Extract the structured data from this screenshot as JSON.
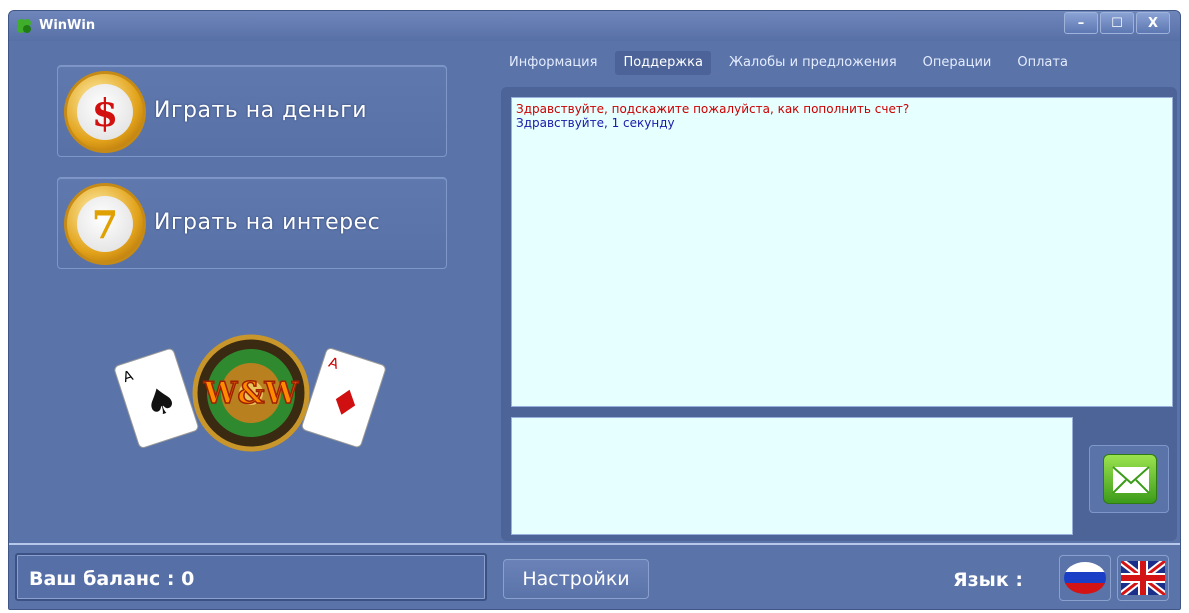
{
  "window": {
    "title": "WinWin",
    "minimize": "–",
    "maximize": "☐",
    "close": "X"
  },
  "left": {
    "play_money": "Играть на деньги",
    "play_interest": "Играть на интерес",
    "money_icon_symbol": "$",
    "interest_icon_symbol": "7"
  },
  "tabs": [
    {
      "label": "Информация"
    },
    {
      "label": "Поддержка",
      "active": true
    },
    {
      "label": "Жалобы и предложения"
    },
    {
      "label": "Операции"
    },
    {
      "label": "Оплата"
    }
  ],
  "chat": {
    "messages": [
      {
        "text": "Здравствуйте, подскажите пожалуйста, как пополнить счет?",
        "color": "#cc0000"
      },
      {
        "text": "Здравствуйте, 1 секунду",
        "color": "#1a1aa8"
      }
    ],
    "input_value": ""
  },
  "bottom": {
    "balance": "Ваш баланс : 0",
    "settings": "Настройки",
    "language_label": "Язык :"
  },
  "icons": {
    "app": "clover-icon",
    "send": "envelope-icon",
    "ru": "russian-flag-icon",
    "en": "uk-flag-icon",
    "logo": "winwin-logo"
  },
  "colors": {
    "window_bg": "#5a73a8",
    "chat_bg": "#e6ffff",
    "accent_green": "#4caf1a"
  }
}
